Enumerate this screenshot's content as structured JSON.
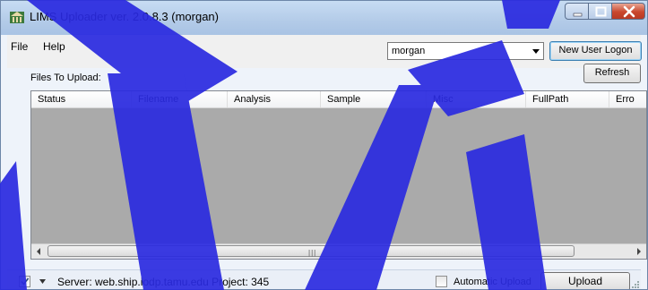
{
  "window": {
    "title": "LIMS Uploader ver. 2.0.8.3  (morgan)",
    "icon": "lims-app-icon"
  },
  "window_controls": {
    "minimize_icon": "minimize-icon",
    "maximize_icon": "maximize-icon",
    "close_icon": "close-icon"
  },
  "menu": {
    "items": [
      {
        "label": "File"
      },
      {
        "label": "Help"
      }
    ]
  },
  "toolbar": {
    "user_selected": "morgan",
    "new_user_logon_label": "New User Logon",
    "refresh_label": "Refresh"
  },
  "files": {
    "label": "Files To Upload:",
    "columns": [
      {
        "label": "Status"
      },
      {
        "label": "Filename"
      },
      {
        "label": "Analysis"
      },
      {
        "label": "Sample"
      },
      {
        "label": "Misc"
      },
      {
        "label": "FullPath"
      },
      {
        "label": "Erro"
      }
    ],
    "rows": []
  },
  "status": {
    "server_text": "Server: web.ship.iodp.tamu.edu  Project: 345",
    "server_checked": true,
    "automatic_upload_label": "Automatic Upload",
    "automatic_upload_checked": false,
    "upload_label": "Upload"
  },
  "colors": {
    "watermark": "#2a2ae0",
    "grid_background": "#aaaaaa",
    "close_button": "#c9472e"
  }
}
